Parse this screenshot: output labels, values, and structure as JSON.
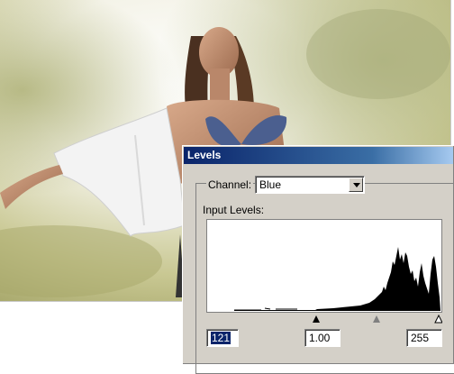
{
  "dialog": {
    "title": "Levels",
    "channel_label": "Channel:",
    "channel_value": "Blue",
    "input_levels_label": "Input Levels:",
    "input_black": "121",
    "input_gamma": "1.00",
    "input_white": "255"
  },
  "colors": {
    "titlebar_start": "#0a246a",
    "titlebar_end": "#a6caf0",
    "dialog_face": "#d4d0c8",
    "selection": "#0a246a"
  }
}
